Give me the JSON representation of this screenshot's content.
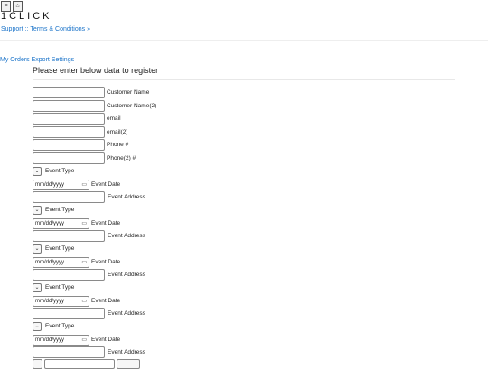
{
  "toolbar": {
    "btn1": "≡",
    "btn2": "⌂"
  },
  "brand": "1CLICK",
  "top_links": {
    "support": "Support",
    "sep": "::",
    "terms": "Terms & Conditions",
    "more": "»"
  },
  "sub_links": {
    "orders": "My Orders",
    "export": "Export Settings"
  },
  "heading": "Please enter below data to register",
  "fields": {
    "customer_name": "Customer Name",
    "customer_name2": "Customer Name(2)",
    "email": "email",
    "email2": "email(2)",
    "phone": "Phone #",
    "phone2": "Phone(2) #"
  },
  "events": [
    {
      "type_label": "Event Type",
      "date_placeholder": "mm/dd/yyyy",
      "date_label": "Event Date",
      "address_label": "Event Address"
    },
    {
      "type_label": "Event Type",
      "date_placeholder": "mm/dd/yyyy",
      "date_label": "Event Date",
      "address_label": "Event Address"
    },
    {
      "type_label": "Event Type",
      "date_placeholder": "mm/dd/yyyy",
      "date_label": "Event Date",
      "address_label": "Event Address"
    },
    {
      "type_label": "Event Type",
      "date_placeholder": "mm/dd/yyyy",
      "date_label": "Event Date",
      "address_label": "Event Address"
    },
    {
      "type_label": "Event Type",
      "date_placeholder": "mm/dd/yyyy",
      "date_label": "Event Date",
      "address_label": "Event Address"
    }
  ],
  "icons": {
    "dropdown": "chevron-down-icon",
    "calendar": "calendar-icon"
  }
}
